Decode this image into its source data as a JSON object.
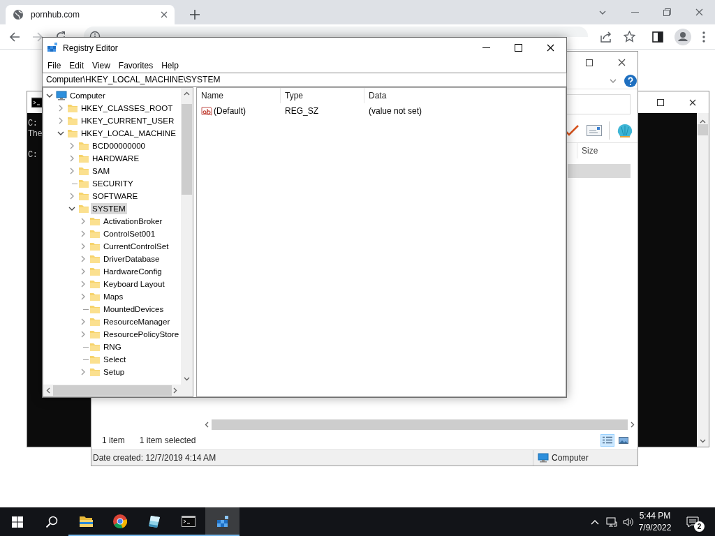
{
  "browser": {
    "tab": {
      "title": "pornhub.com",
      "selected": true
    }
  },
  "cmd_window": {
    "blocks": [
      {
        "lines": [
          "C:",
          "The"
        ]
      },
      {
        "lines": [
          "C:"
        ]
      }
    ]
  },
  "explorer_window": {
    "size_column": "Size",
    "rows": [
      {
        "selected": true
      }
    ],
    "status_items": [
      "1 item",
      "1 item selected"
    ],
    "views": [
      {
        "kind": "details",
        "selected": true
      },
      {
        "kind": "preview",
        "selected": false
      }
    ],
    "details": "Date created: 12/7/2019 4:14 AM",
    "location": "Computer"
  },
  "registry": {
    "title": "Registry Editor",
    "menu": [
      "File",
      "Edit",
      "View",
      "Favorites",
      "Help"
    ],
    "address": "Computer\\HKEY_LOCAL_MACHINE\\SYSTEM",
    "tree": [
      {
        "label": "Computer",
        "kind": "computer",
        "has_children": true,
        "expanded": true,
        "selected": false,
        "children": [
          {
            "label": "HKEY_CLASSES_ROOT",
            "kind": "folder",
            "has_children": true,
            "expanded": false,
            "selected": false
          },
          {
            "label": "HKEY_CURRENT_USER",
            "kind": "folder",
            "has_children": true,
            "expanded": false,
            "selected": false
          },
          {
            "label": "HKEY_LOCAL_MACHINE",
            "kind": "folder",
            "has_children": true,
            "expanded": true,
            "selected": false,
            "children": [
              {
                "label": "BCD00000000",
                "kind": "folder",
                "has_children": true,
                "expanded": false,
                "selected": false
              },
              {
                "label": "HARDWARE",
                "kind": "folder",
                "has_children": true,
                "expanded": false,
                "selected": false
              },
              {
                "label": "SAM",
                "kind": "folder",
                "has_children": true,
                "expanded": false,
                "selected": false
              },
              {
                "label": "SECURITY",
                "kind": "folder",
                "has_children": false,
                "selected": false
              },
              {
                "label": "SOFTWARE",
                "kind": "folder",
                "has_children": true,
                "expanded": false,
                "selected": false
              },
              {
                "label": "SYSTEM",
                "kind": "folder",
                "has_children": true,
                "expanded": true,
                "selected": true,
                "children": [
                  {
                    "label": "ActivationBroker",
                    "kind": "folder",
                    "has_children": true,
                    "expanded": false,
                    "selected": false
                  },
                  {
                    "label": "ControlSet001",
                    "kind": "folder",
                    "has_children": true,
                    "expanded": false,
                    "selected": false
                  },
                  {
                    "label": "CurrentControlSet",
                    "kind": "folder",
                    "has_children": true,
                    "expanded": false,
                    "selected": false
                  },
                  {
                    "label": "DriverDatabase",
                    "kind": "folder",
                    "has_children": true,
                    "expanded": false,
                    "selected": false
                  },
                  {
                    "label": "HardwareConfig",
                    "kind": "folder",
                    "has_children": true,
                    "expanded": false,
                    "selected": false
                  },
                  {
                    "label": "Keyboard Layout",
                    "kind": "folder",
                    "has_children": true,
                    "expanded": false,
                    "selected": false
                  },
                  {
                    "label": "Maps",
                    "kind": "folder",
                    "has_children": true,
                    "expanded": false,
                    "selected": false
                  },
                  {
                    "label": "MountedDevices",
                    "kind": "folder",
                    "has_children": false,
                    "selected": false
                  },
                  {
                    "label": "ResourceManager",
                    "kind": "folder",
                    "has_children": true,
                    "expanded": false,
                    "selected": false
                  },
                  {
                    "label": "ResourcePolicyStore",
                    "kind": "folder",
                    "has_children": true,
                    "expanded": false,
                    "selected": false
                  },
                  {
                    "label": "RNG",
                    "kind": "folder",
                    "has_children": false,
                    "selected": false
                  },
                  {
                    "label": "Select",
                    "kind": "folder",
                    "has_children": false,
                    "selected": false
                  },
                  {
                    "label": "Setup",
                    "kind": "folder",
                    "has_children": true,
                    "expanded": false,
                    "selected": false
                  }
                ]
              }
            ]
          }
        ]
      }
    ],
    "columns": [
      "Name",
      "Type",
      "Data"
    ],
    "values": [
      {
        "name": "(Default)",
        "type": "REG_SZ",
        "data": "(value not set)",
        "kind": "string"
      }
    ]
  },
  "taskbar": {
    "apps": [
      {
        "kind": "start",
        "running": false,
        "selected": false
      },
      {
        "kind": "search",
        "running": false,
        "selected": false
      },
      {
        "kind": "explorer",
        "running": true,
        "selected": false
      },
      {
        "kind": "browser",
        "running": true,
        "selected": false
      },
      {
        "kind": "notepad",
        "running": true,
        "selected": false
      },
      {
        "kind": "terminal",
        "running": true,
        "selected": false
      },
      {
        "kind": "registry",
        "running": true,
        "selected": true
      }
    ],
    "clock": {
      "time": "5:44 PM",
      "date": "7/9/2022"
    },
    "notifications": "2"
  }
}
